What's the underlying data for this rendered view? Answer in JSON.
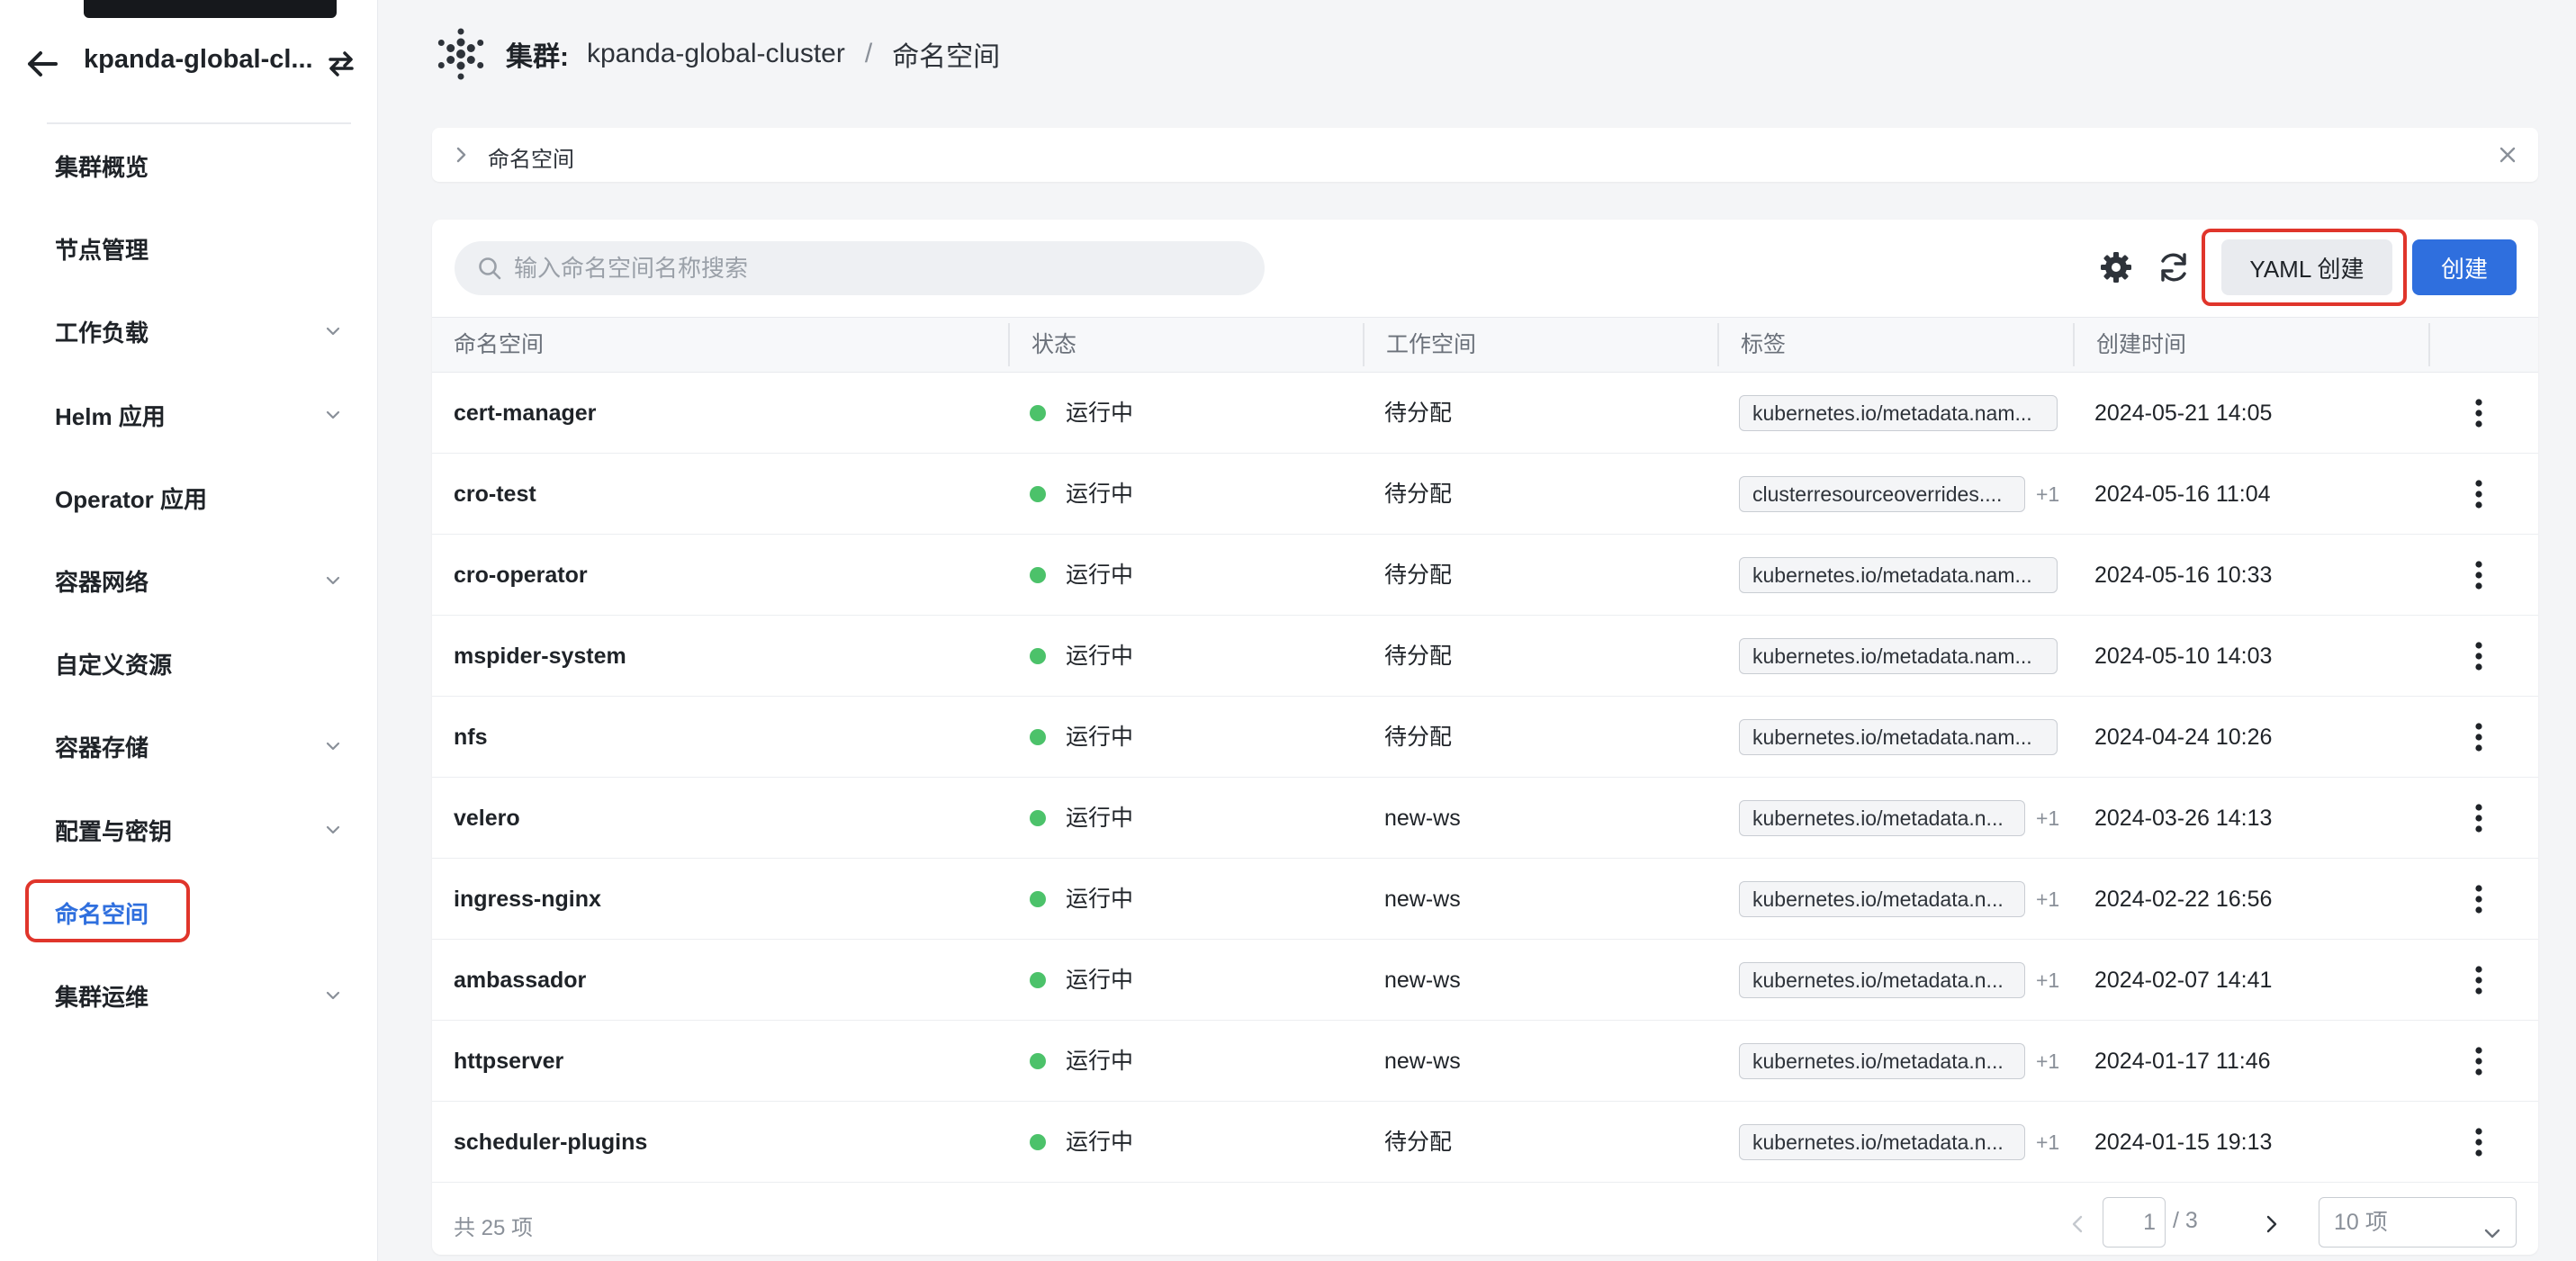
{
  "sidebar": {
    "cluster_name": "kpanda-global-cl...",
    "items": [
      {
        "label": "集群概览",
        "expandable": false,
        "active": false
      },
      {
        "label": "节点管理",
        "expandable": false,
        "active": false
      },
      {
        "label": "工作负载",
        "expandable": true,
        "active": false
      },
      {
        "label": "Helm 应用",
        "expandable": true,
        "active": false
      },
      {
        "label": "Operator 应用",
        "expandable": false,
        "active": false
      },
      {
        "label": "容器网络",
        "expandable": true,
        "active": false
      },
      {
        "label": "自定义资源",
        "expandable": false,
        "active": false
      },
      {
        "label": "容器存储",
        "expandable": true,
        "active": false
      },
      {
        "label": "配置与密钥",
        "expandable": true,
        "active": false
      },
      {
        "label": "命名空间",
        "expandable": false,
        "active": true
      },
      {
        "label": "集群运维",
        "expandable": true,
        "active": false
      }
    ]
  },
  "breadcrumb": {
    "label": "集群:",
    "cluster": "kpanda-global-cluster",
    "separator": "/",
    "current": "命名空间"
  },
  "collapse_panel": {
    "title": "命名空间"
  },
  "toolbar": {
    "search_placeholder": "输入命名空间名称搜索",
    "yaml_create_label": "YAML 创建",
    "create_label": "创建"
  },
  "table": {
    "columns": [
      "命名空间",
      "状态",
      "工作空间",
      "标签",
      "创建时间"
    ],
    "rows": [
      {
        "name": "cert-manager",
        "status": "运行中",
        "workspace": "待分配",
        "tag": "kubernetes.io/metadata.nam...",
        "extra": "",
        "created": "2024-05-21 14:05"
      },
      {
        "name": "cro-test",
        "status": "运行中",
        "workspace": "待分配",
        "tag": "clusterresourceoverrides....",
        "extra": "+1",
        "created": "2024-05-16 11:04"
      },
      {
        "name": "cro-operator",
        "status": "运行中",
        "workspace": "待分配",
        "tag": "kubernetes.io/metadata.nam...",
        "extra": "",
        "created": "2024-05-16 10:33"
      },
      {
        "name": "mspider-system",
        "status": "运行中",
        "workspace": "待分配",
        "tag": "kubernetes.io/metadata.nam...",
        "extra": "",
        "created": "2024-05-10 14:03"
      },
      {
        "name": "nfs",
        "status": "运行中",
        "workspace": "待分配",
        "tag": "kubernetes.io/metadata.nam...",
        "extra": "",
        "created": "2024-04-24 10:26"
      },
      {
        "name": "velero",
        "status": "运行中",
        "workspace": "new-ws",
        "tag": "kubernetes.io/metadata.n...",
        "extra": "+1",
        "created": "2024-03-26 14:13"
      },
      {
        "name": "ingress-nginx",
        "status": "运行中",
        "workspace": "new-ws",
        "tag": "kubernetes.io/metadata.n...",
        "extra": "+1",
        "created": "2024-02-22 16:56"
      },
      {
        "name": "ambassador",
        "status": "运行中",
        "workspace": "new-ws",
        "tag": "kubernetes.io/metadata.n...",
        "extra": "+1",
        "created": "2024-02-07 14:41"
      },
      {
        "name": "httpserver",
        "status": "运行中",
        "workspace": "new-ws",
        "tag": "kubernetes.io/metadata.n...",
        "extra": "+1",
        "created": "2024-01-17 11:46"
      },
      {
        "name": "scheduler-plugins",
        "status": "运行中",
        "workspace": "待分配",
        "tag": "kubernetes.io/metadata.n...",
        "extra": "+1",
        "created": "2024-01-15 19:13"
      }
    ]
  },
  "pagination": {
    "total": "共 25 项",
    "current_page": "1",
    "total_pages": "/ 3",
    "page_size": "10 项"
  },
  "colors": {
    "primary": "#2f6fde",
    "highlight": "#e0352b",
    "status_running": "#4cc26a"
  }
}
